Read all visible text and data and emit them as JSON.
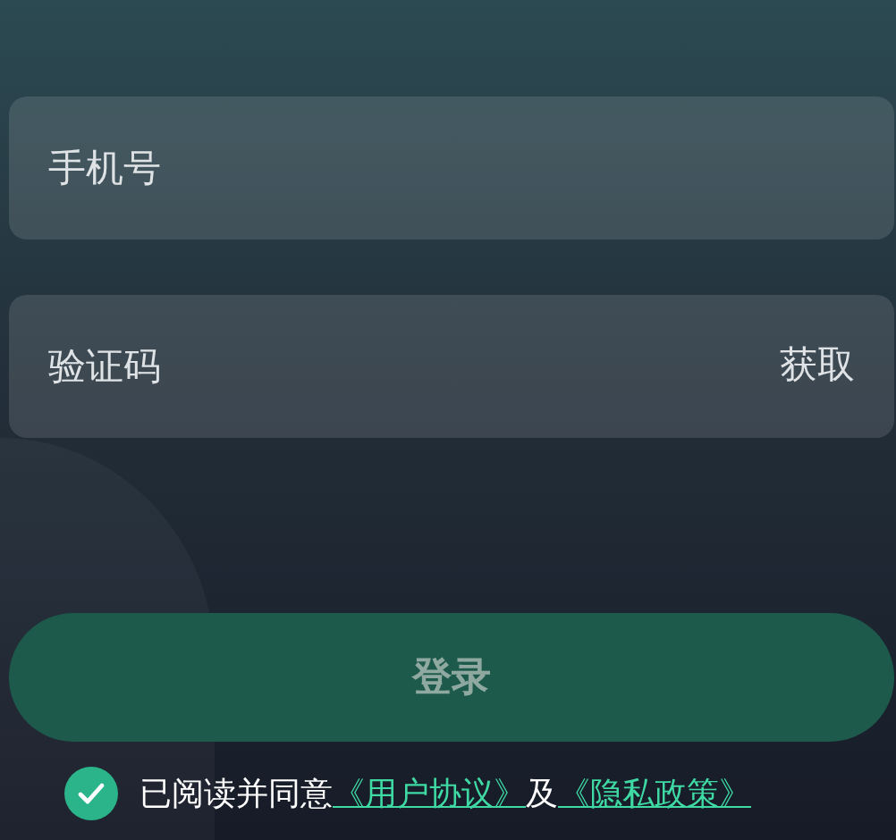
{
  "phone_field": {
    "placeholder": "手机号"
  },
  "code_field": {
    "placeholder": "验证码"
  },
  "get_code_button": {
    "label": "获取"
  },
  "login_button": {
    "label": "登录"
  },
  "agreement": {
    "checked": true,
    "text": "已阅读并同意",
    "links": [
      {
        "label": "《用户协议》"
      },
      {
        "label": "《隐私政策》"
      }
    ],
    "joiner": "及"
  }
}
